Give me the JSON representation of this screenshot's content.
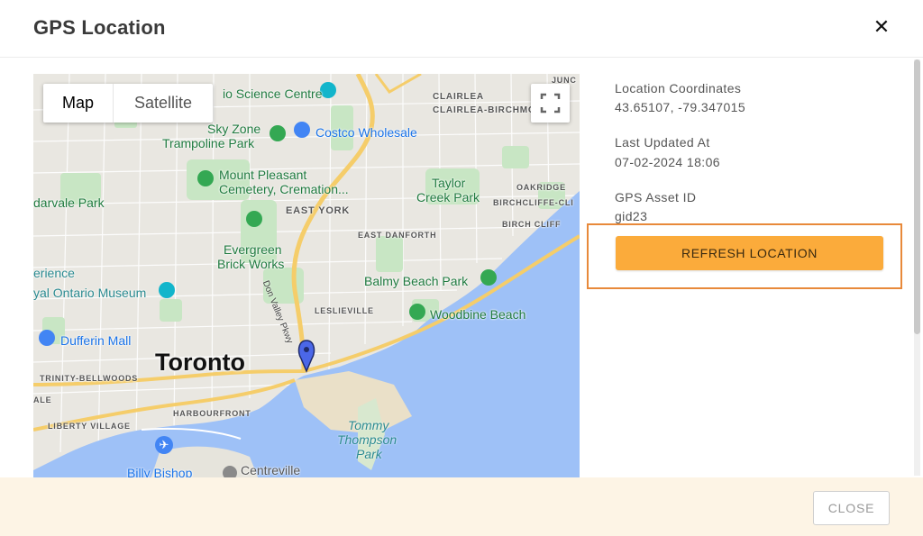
{
  "dialog": {
    "title": "GPS Location",
    "close_icon": "close-icon"
  },
  "map": {
    "map_type": {
      "map_label": "Map",
      "satellite_label": "Satellite",
      "selected": "Map"
    },
    "fullscreen_icon": "fullscreen-icon",
    "labels": {
      "science_centre": "io Science Centre",
      "junc": "JUNC",
      "clairlea": "CLAIRLEA",
      "clairlea_birchmount": "CLAIRLEA-BIRCHMO",
      "sky_zone_1": "Sky Zone",
      "sky_zone_2": "Trampoline Park",
      "costco": "Costco Wholesale",
      "mount_pleasant_1": "Mount Pleasant",
      "mount_pleasant_2": "Cemetery, Cremation...",
      "taylor_creek_1": "Taylor",
      "taylor_creek_2": "Creek Park",
      "oakridge": "OAKRIDGE",
      "birchcliffe": "BIRCHCLIFFE-CLI",
      "dvarale": "darvale Park",
      "east_york": "EAST YORK",
      "birch_cliff": "BIRCH CLIFF",
      "evergreen_1": "Evergreen",
      "evergreen_2": "Brick Works",
      "east_danforth": "EAST DANFORTH",
      "science_left": "erience",
      "rom": "yal Ontario Museum",
      "balmy_beach": "Balmy Beach Park",
      "leslieville": "LESLIEVILLE",
      "don_valley": "Don Valley Pkwy",
      "woodbine": "Woodbine Beach",
      "dufferin": "Dufferin Mall",
      "toronto": "Toronto",
      "trinity": "TRINITY-BELLWOODS",
      "ale": "ALE",
      "harbourfront": "HARBOURFRONT",
      "liberty": "LIBERTY VILLAGE",
      "tommy_1": "Tommy",
      "tommy_2": "Thompson",
      "tommy_3": "Park",
      "billy_bishop": "Billy Bishop",
      "centreville": "Centreville"
    },
    "marker_icon": "location-pin-icon"
  },
  "info": {
    "coords_label": "Location Coordinates",
    "coords_value": "43.65107, -79.347015",
    "updated_label": "Last Updated At",
    "updated_value": "07-02-2024 18:06",
    "asset_label": "GPS Asset ID",
    "asset_value": "gid23"
  },
  "actions": {
    "refresh_label": "REFRESH LOCATION",
    "close_label": "CLOSE"
  },
  "colors": {
    "refresh_button": "#fbab3b",
    "highlight_border": "#e8893a",
    "footer_bg": "#fdf4e5",
    "water": "#9cc0f9",
    "park": "#c5e8c5",
    "highway": "#f8d16a"
  }
}
